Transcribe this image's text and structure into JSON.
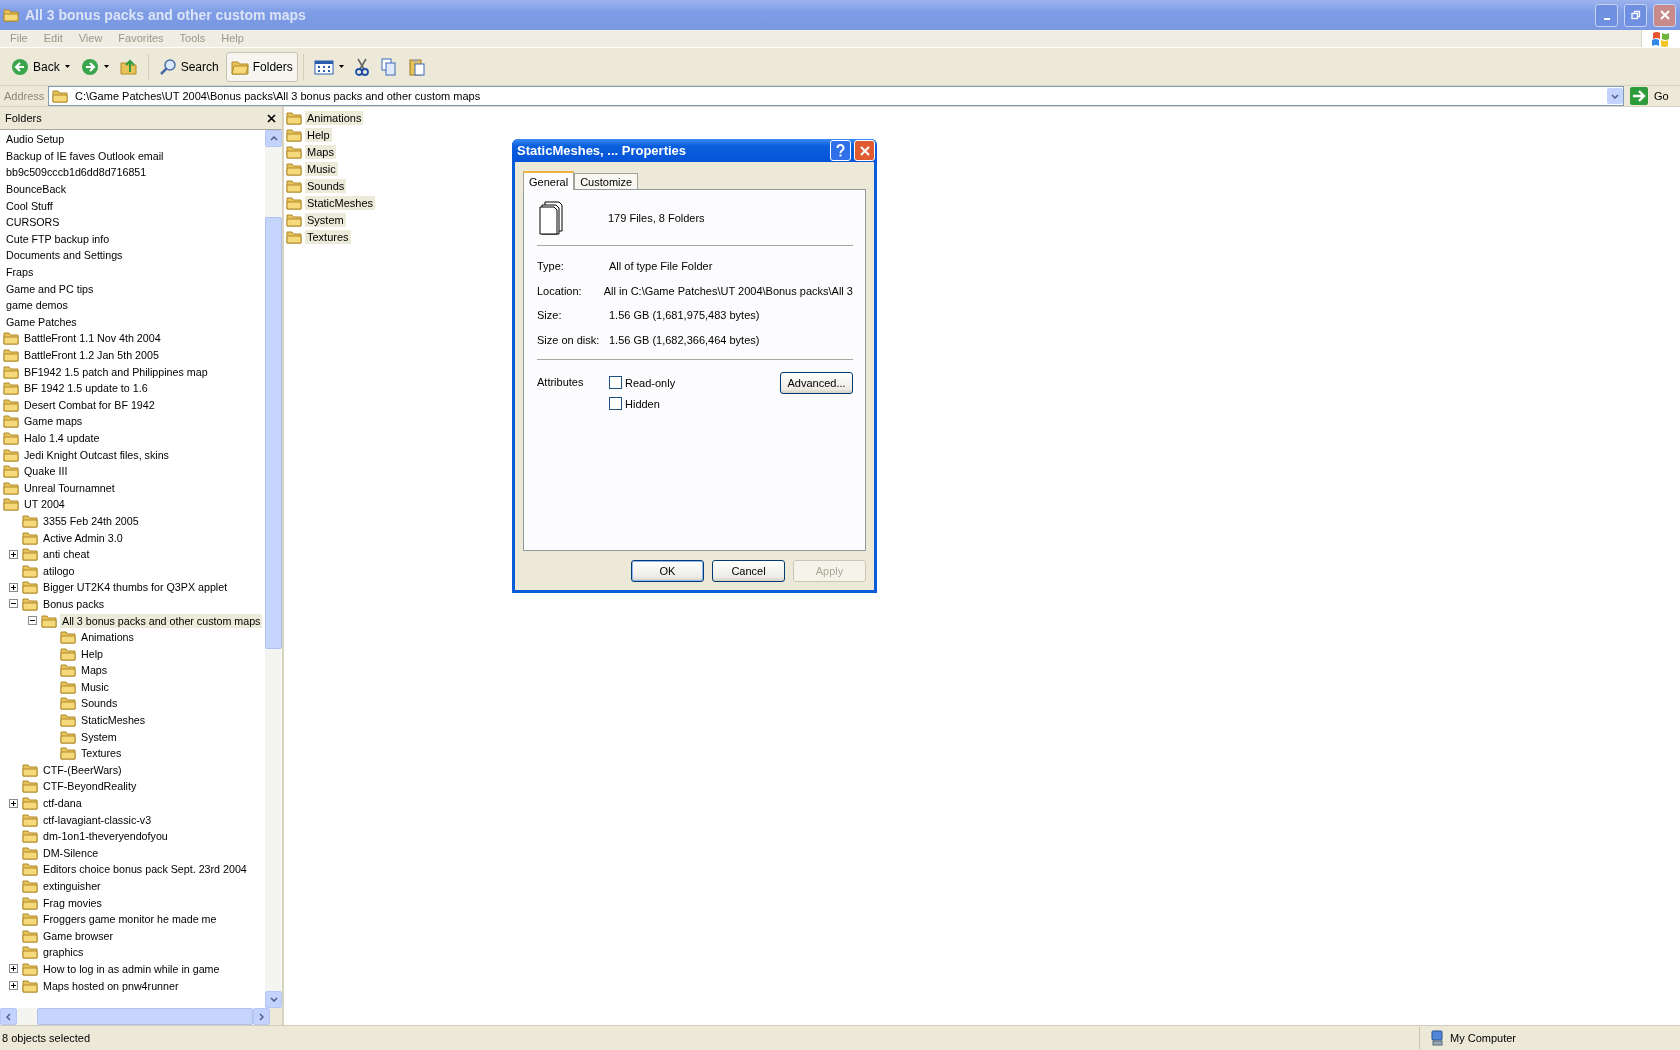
{
  "window": {
    "title": "All 3 bonus packs and other custom maps"
  },
  "menu": [
    {
      "label": "File"
    },
    {
      "label": "Edit"
    },
    {
      "label": "View"
    },
    {
      "label": "Favorites"
    },
    {
      "label": "Tools"
    },
    {
      "label": "Help"
    }
  ],
  "toolbar": [
    {
      "kind": "back",
      "label": "Back",
      "pressed": false
    },
    {
      "kind": "forward",
      "pressed": false
    },
    {
      "kind": "up",
      "pressed": false
    },
    {
      "kind": "search",
      "label": "Search",
      "pressed": false
    },
    {
      "kind": "folders",
      "label": "Folders",
      "pressed": true
    },
    {
      "kind": "views",
      "pressed": false
    },
    {
      "kind": "cut",
      "pressed": false
    },
    {
      "kind": "copy",
      "pressed": false
    },
    {
      "kind": "paste",
      "pressed": false
    }
  ],
  "address": {
    "label": "Address",
    "value": "C:\\Game Patches\\UT 2004\\Bonus packs\\All 3 bonus packs and other custom maps",
    "go": "Go"
  },
  "folders_pane": {
    "title": "Folders",
    "tree": [
      {
        "label": "Audio Setup",
        "selected": false
      },
      {
        "label": "Backup of IE faves Outlook email",
        "selected": false
      },
      {
        "label": "bb9c509cccb1d6dd8d716851",
        "selected": false
      },
      {
        "label": "BounceBack",
        "selected": false
      },
      {
        "label": "Cool Stuff",
        "selected": false
      },
      {
        "label": "CURSORS",
        "selected": false
      },
      {
        "label": "Cute FTP backup info",
        "selected": false
      },
      {
        "label": "Documents and Settings",
        "selected": false
      },
      {
        "label": "Fraps",
        "selected": false
      },
      {
        "label": "Game and PC tips",
        "selected": false
      },
      {
        "label": "game demos",
        "selected": false
      },
      {
        "label": "Game Patches",
        "selected": false,
        "children": [
          {
            "label": "BattleFront 1.1 Nov 4th 2004",
            "selected": false
          },
          {
            "label": "BattleFront 1.2 Jan 5th 2005",
            "selected": false
          },
          {
            "label": "BF1942 1.5 patch and Philippines map",
            "selected": false
          },
          {
            "label": "BF 1942 1.5 update to 1.6",
            "selected": false
          },
          {
            "label": "Desert Combat for BF 1942",
            "selected": false
          },
          {
            "label": "Game maps",
            "selected": false
          },
          {
            "label": "Halo 1.4 update",
            "selected": false
          },
          {
            "label": "Jedi Knight Outcast files, skins",
            "selected": false
          },
          {
            "label": "Quake III",
            "selected": false
          },
          {
            "label": "Unreal Tournamnet",
            "selected": false
          },
          {
            "label": "UT 2004",
            "selected": false,
            "children": [
              {
                "label": "3355 Feb 24th 2005",
                "selected": false
              },
              {
                "label": "Active Admin 3.0",
                "selected": false
              },
              {
                "label": "anti cheat",
                "selected": false,
                "expanded": false
              },
              {
                "label": "atilogo",
                "selected": false
              },
              {
                "label": "Bigger UT2K4 thumbs for Q3PX applet",
                "selected": false,
                "expanded": false
              },
              {
                "label": "Bonus packs",
                "selected": false,
                "expanded": true,
                "children": [
                  {
                    "label": "All 3 bonus packs and other custom maps",
                    "selected": true,
                    "expanded": true,
                    "children": [
                      {
                        "label": "Animations",
                        "selected": false
                      },
                      {
                        "label": "Help",
                        "selected": false
                      },
                      {
                        "label": "Maps",
                        "selected": false
                      },
                      {
                        "label": "Music",
                        "selected": false
                      },
                      {
                        "label": "Sounds",
                        "selected": false
                      },
                      {
                        "label": "StaticMeshes",
                        "selected": false
                      },
                      {
                        "label": "System",
                        "selected": false
                      },
                      {
                        "label": "Textures",
                        "selected": false
                      }
                    ]
                  }
                ]
              },
              {
                "label": "CTF-(BeerWars)",
                "selected": false
              },
              {
                "label": "CTF-BeyondReality",
                "selected": false
              },
              {
                "label": "ctf-dana",
                "selected": false,
                "expanded": false
              },
              {
                "label": "ctf-lavagiant-classic-v3",
                "selected": false
              },
              {
                "label": "dm-1on1-theveryendofyou",
                "selected": false
              },
              {
                "label": "DM-Silence",
                "selected": false
              },
              {
                "label": "Editors choice bonus pack Sept. 23rd 2004",
                "selected": false
              },
              {
                "label": "extinguisher",
                "selected": false
              },
              {
                "label": "Frag movies",
                "selected": false
              },
              {
                "label": "Froggers game monitor he made me",
                "selected": false
              },
              {
                "label": "Game browser",
                "selected": false
              },
              {
                "label": "graphics",
                "selected": false
              },
              {
                "label": "How to log in as admin while in game",
                "selected": false,
                "expanded": false
              },
              {
                "label": "Maps hosted on pnw4runner",
                "selected": false,
                "expanded": false
              }
            ]
          }
        ]
      }
    ]
  },
  "contents": [
    {
      "name": "Animations",
      "selected": true
    },
    {
      "name": "Help",
      "selected": true
    },
    {
      "name": "Maps",
      "selected": true
    },
    {
      "name": "Music",
      "selected": true
    },
    {
      "name": "Sounds",
      "selected": true
    },
    {
      "name": "StaticMeshes",
      "selected": true
    },
    {
      "name": "System",
      "selected": true
    },
    {
      "name": "Textures",
      "selected": true
    }
  ],
  "dialog": {
    "title": "StaticMeshes, ... Properties",
    "tabs": [
      {
        "label": "General",
        "selected": true
      },
      {
        "label": "Customize",
        "selected": false
      }
    ],
    "summary": "179 Files, 8 Folders",
    "properties": [
      {
        "label": "Type:",
        "value": "All of type File Folder"
      },
      {
        "label": "Location:",
        "value": "All in C:\\Game Patches\\UT 2004\\Bonus packs\\All 3"
      },
      {
        "label": "Size:",
        "value": "1.56 GB (1,681,975,483 bytes)"
      },
      {
        "label": "Size on disk:",
        "value": "1.56 GB (1,682,366,464 bytes)"
      }
    ],
    "attributes_label": "Attributes",
    "attributes": [
      {
        "label": "Read-only",
        "checked": false
      },
      {
        "label": "Hidden",
        "checked": false
      }
    ],
    "advanced": "Advanced...",
    "buttons": [
      {
        "label": "OK",
        "default": true,
        "disabled": false
      },
      {
        "label": "Cancel",
        "default": false,
        "disabled": false
      },
      {
        "label": "Apply",
        "default": false,
        "disabled": true
      }
    ]
  },
  "status_bar": {
    "text": "8 objects selected",
    "zone": "My Computer"
  }
}
